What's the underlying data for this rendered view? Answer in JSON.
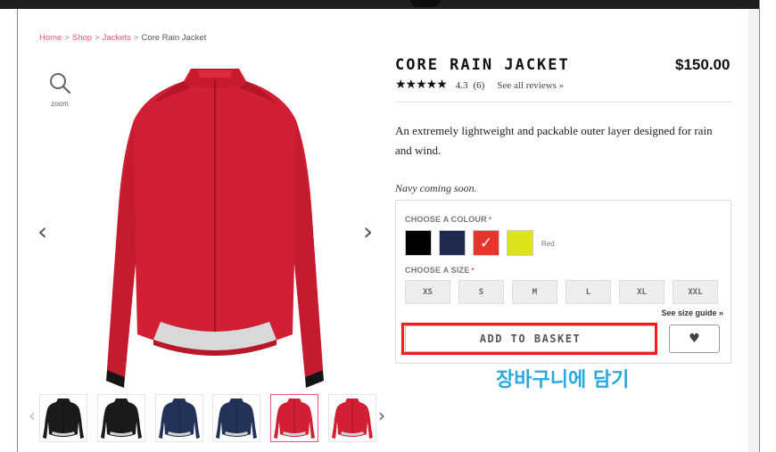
{
  "breadcrumb": {
    "home": "Home",
    "shop": "Shop",
    "jackets": "Jackets",
    "current": "Core Rain Jacket",
    "separator": ">"
  },
  "gallery": {
    "zoom_label": "zoom",
    "prev_arrow": "‹",
    "next_arrow": "›",
    "thumb_prev": "‹",
    "thumb_next": "›",
    "thumbnail_colors": [
      "#1a1a1a",
      "#1a1a1a",
      "#24325a",
      "#24325a",
      "#d31f33",
      "#d31f33"
    ],
    "selected_thumbnail": 4
  },
  "product": {
    "title": "CORE RAIN JACKET",
    "price": "$150.00",
    "stars": "★★★★★",
    "rating": "4.3",
    "review_count": "(6)",
    "reviews_link": "See all reviews »",
    "description": "An extremely lightweight and packable outer layer designed for rain and wind.",
    "note": "Navy coming soon."
  },
  "options": {
    "colour_label": "CHOOSE A COLOUR",
    "required_mark": "*",
    "colours": [
      {
        "name": "Black",
        "hex": "#000000"
      },
      {
        "name": "Navy",
        "hex": "#1f2a4f"
      },
      {
        "name": "Red",
        "hex": "#e8352b"
      },
      {
        "name": "Yellow",
        "hex": "#dde31a"
      }
    ],
    "selected_colour_index": 2,
    "selected_colour_name": "Red",
    "check_mark": "✓",
    "size_label": "CHOOSE A SIZE",
    "sizes": [
      "XS",
      "S",
      "M",
      "L",
      "XL",
      "XXL"
    ],
    "size_guide": "See size guide »",
    "add_to_basket": "ADD TO BASKET",
    "wishlist_icon": "♥"
  },
  "annotation": {
    "text": "장바구니에 담기",
    "highlight_color": "#ff1a1a",
    "text_color": "#2aa8e0"
  },
  "colors": {
    "accent": "#e8547a",
    "jacket_red": "#d31f33"
  }
}
